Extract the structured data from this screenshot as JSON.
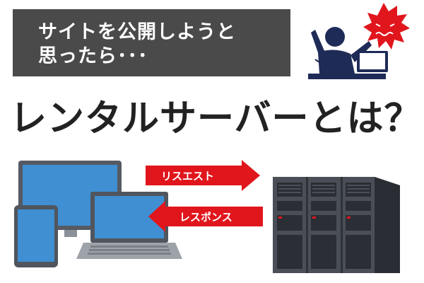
{
  "banner": {
    "line1": "サイトを公開しようと",
    "line2": "思ったら･･･"
  },
  "title": "レンタルサーバーとは？",
  "arrows": {
    "request_label": "リスエスト",
    "response_label": "レスポンス"
  },
  "icons": {
    "person": "frustrated-person-icon",
    "anger": "anger-burst-icon",
    "devices": [
      "monitor-icon",
      "tablet-icon",
      "laptop-icon"
    ],
    "server": "server-rack-icon"
  },
  "colors": {
    "banner_bg": "#4a4a4a",
    "arrow_red": "#e0161c",
    "navy": "#1f2b57",
    "screen_blue": "#3f8fd2"
  }
}
